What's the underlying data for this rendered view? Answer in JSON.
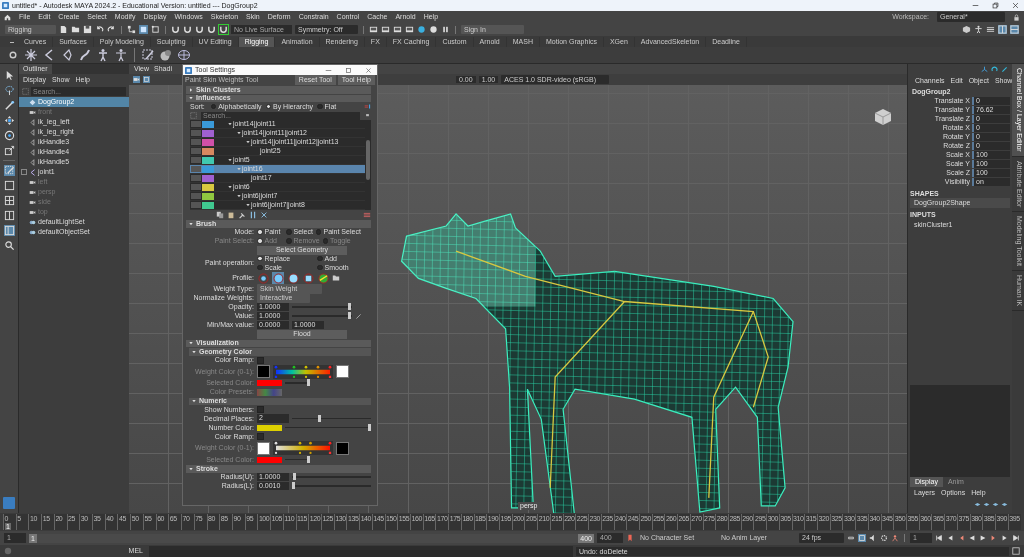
{
  "window": {
    "title": "untitled* - Autodesk MAYA 2024.2 - Educational Version: untitled  ---  DogGroup2"
  },
  "menu_bar": {
    "items": [
      "File",
      "Edit",
      "Create",
      "Select",
      "Modify",
      "Display",
      "Windows",
      "Skeleton",
      "Skin",
      "Deform",
      "Constrain",
      "Control",
      "Cache",
      "Arnold",
      "Help"
    ],
    "workspace_label": "Workspace:",
    "workspace_value": "General*"
  },
  "status_line": {
    "menu_set": "Rigging",
    "live_surface": "No Live Surface",
    "symmetry": "Symmetry: Off",
    "sign_in": "Sign In"
  },
  "shelf": {
    "tabs": [
      {
        "label": "Curves",
        "selected": false
      },
      {
        "label": "Surfaces",
        "selected": false
      },
      {
        "label": "Poly Modeling",
        "selected": false
      },
      {
        "label": "Sculpting",
        "selected": false
      },
      {
        "label": "UV Editing",
        "selected": false
      },
      {
        "label": "Rigging",
        "selected": true
      },
      {
        "label": "Animation",
        "selected": false
      },
      {
        "label": "Rendering",
        "selected": false
      },
      {
        "label": "FX",
        "selected": false
      },
      {
        "label": "FX Caching",
        "selected": false
      },
      {
        "label": "Custom",
        "selected": false
      },
      {
        "label": "Arnold",
        "selected": false
      },
      {
        "label": "MASH",
        "selected": false
      },
      {
        "label": "Motion Graphics",
        "selected": false
      },
      {
        "label": "XGen",
        "selected": false
      },
      {
        "label": "AdvancedSkeleton",
        "selected": false
      },
      {
        "label": "Deadline",
        "selected": false
      }
    ]
  },
  "outliner": {
    "title": "Outliner",
    "menu": [
      "Display",
      "Show",
      "Help"
    ],
    "search_placeholder": "Search...",
    "items": [
      {
        "label": "DogGroup2",
        "kind": "group",
        "selected": true,
        "hidden": false
      },
      {
        "label": "front",
        "kind": "camera",
        "selected": false,
        "hidden": true
      },
      {
        "label": "ik_leg_left",
        "kind": "ik",
        "selected": false,
        "hidden": false
      },
      {
        "label": "ik_leg_right",
        "kind": "ik",
        "selected": false,
        "hidden": false
      },
      {
        "label": "ikHandle3",
        "kind": "ik",
        "selected": false,
        "hidden": false
      },
      {
        "label": "ikHandle4",
        "kind": "ik",
        "selected": false,
        "hidden": false
      },
      {
        "label": "ikHandle5",
        "kind": "ik",
        "selected": false,
        "hidden": false
      },
      {
        "label": "joint1",
        "kind": "joint",
        "selected": false,
        "hidden": false
      },
      {
        "label": "left",
        "kind": "camera",
        "selected": false,
        "hidden": true
      },
      {
        "label": "persp",
        "kind": "camera",
        "selected": false,
        "hidden": true
      },
      {
        "label": "side",
        "kind": "camera",
        "selected": false,
        "hidden": true
      },
      {
        "label": "top",
        "kind": "camera",
        "selected": false,
        "hidden": true
      },
      {
        "label": "defaultLightSet",
        "kind": "set",
        "selected": false,
        "hidden": false
      },
      {
        "label": "defaultObjectSet",
        "kind": "set",
        "selected": false,
        "hidden": false
      }
    ]
  },
  "viewport": {
    "menu": [
      "View",
      "Shadi"
    ],
    "exposure": "0.00",
    "gamma": "1.00",
    "color_space": "ACES 1.0 SDR-video (sRGB)",
    "camera": "persp"
  },
  "tool_settings": {
    "title": "Tool Settings",
    "tool_name": "Paint Skin Weights Tool",
    "buttons": [
      "Reset Tool",
      "Tool Help"
    ],
    "skin_clusters": {
      "label": "Skin Clusters",
      "expanded": false
    },
    "influences": {
      "label": "Influences",
      "expanded": true,
      "sort_label": "Sort:",
      "sort_options": [
        {
          "label": "Alphabetically",
          "selected": false
        },
        {
          "label": "By Hierarchy",
          "selected": true
        },
        {
          "label": "Flat",
          "selected": false
        }
      ],
      "search_placeholder": "Search...",
      "rows": [
        {
          "label": "joint14|joint11",
          "color": "#3a9ad9",
          "selected": false,
          "expanded": true,
          "children": [
            {
              "label": "joint14|joint11|joint12",
              "color": "#a060d0",
              "selected": false,
              "expanded": true,
              "children": [
                {
                  "label": "joint14|joint11|joint12|joint13",
                  "color": "#d050a8",
                  "selected": false,
                  "expanded": true,
                  "children": [
                    {
                      "label": "joint25",
                      "color": "#d88860",
                      "selected": false,
                      "expanded": false
                    }
                  ]
                }
              ]
            }
          ]
        },
        {
          "label": "joint5",
          "color": "#40c8b0",
          "selected": false,
          "expanded": true,
          "children": [
            {
              "label": "joint16",
              "color": "#3a9ad9",
              "selected": true,
              "expanded": true,
              "children": [
                {
                  "label": "joint17",
                  "color": "#a060d0",
                  "selected": false,
                  "expanded": false
                }
              ]
            }
          ]
        },
        {
          "label": "joint6",
          "color": "#d8c840",
          "selected": false,
          "expanded": true,
          "children": [
            {
              "label": "joint6|joint7",
              "color": "#90c840",
              "selected": false,
              "expanded": true,
              "children": [
                {
                  "label": "joint6|joint7|joint8",
                  "color": "#40c890",
                  "selected": false,
                  "expanded": true
                }
              ]
            }
          ]
        }
      ]
    },
    "brush": {
      "label": "Brush",
      "expanded": true,
      "mode": {
        "label": "Mode:",
        "disabled": false,
        "options": [
          {
            "label": "Paint",
            "selected": true
          },
          {
            "label": "Select",
            "selected": false
          },
          {
            "label": "Paint Select",
            "selected": false
          }
        ]
      },
      "paint_select": {
        "label": "Paint Select:",
        "disabled": true,
        "options": [
          {
            "label": "Add",
            "selected": true
          },
          {
            "label": "Remove",
            "selected": false
          },
          {
            "label": "Toggle",
            "selected": false
          }
        ]
      },
      "select_geometry": "Select Geometry",
      "paint_operation": {
        "label": "Paint operation:",
        "options": [
          {
            "label": "Replace",
            "selected": true
          },
          {
            "label": "Add",
            "selected": false
          },
          {
            "label": "Scale",
            "selected": false
          },
          {
            "label": "Smooth",
            "selected": false
          }
        ]
      },
      "profile_label": "Profile:",
      "profiles": [
        {
          "kind": "soft",
          "selected": false
        },
        {
          "kind": "gaussian",
          "selected": true
        },
        {
          "kind": "solid",
          "selected": false
        },
        {
          "kind": "square",
          "selected": false
        },
        {
          "kind": "image",
          "selected": false
        }
      ],
      "weight_type": {
        "label": "Weight Type:",
        "value": "Skin Weight"
      },
      "normalize": {
        "label": "Normalize Weights:",
        "value": "Interactive"
      },
      "opacity": {
        "label": "Opacity:",
        "value": "1.0000",
        "level": 1
      },
      "value": {
        "label": "Value:",
        "value": "1.0000",
        "level": 1
      },
      "minmax": {
        "label": "Min/Max value:",
        "min": "0.0000",
        "max": "1.0000"
      },
      "flood": "Flood"
    },
    "visualization": {
      "label": "Visualization",
      "expanded": true
    },
    "geometry_color": {
      "label": "Geometry Color",
      "expanded": true,
      "color_ramp_label": "Color Ramp:",
      "color_ramp": false,
      "weight_color_label": "Weight Color (0-1):",
      "selected_color_label": "Selected Color:",
      "color_presets_label": "Color Presets:"
    },
    "numeric": {
      "label": "Numeric",
      "expanded": true,
      "show_numbers_label": "Show Numbers:",
      "show_numbers": false,
      "decimal_places_label": "Decimal Places:",
      "decimal_places": {
        "value": "2",
        "level": 0.35
      },
      "number_color_label": "Number Color:",
      "color_ramp_label": "Color Ramp:",
      "color_ramp": false,
      "weight_color_label": "Weight Color (0-1):",
      "selected_color_label": "Selected Color:"
    },
    "stroke": {
      "label": "Stroke",
      "expanded": true,
      "radius_u_label": "Radius(U):",
      "radius_u": {
        "value": "1.0000",
        "level": 0.02
      },
      "radius_l_label": "Radius(L):",
      "radius_l": {
        "value": "0.0010",
        "level": 0
      }
    }
  },
  "channel_box": {
    "menu": [
      "Channels",
      "Edit",
      "Object",
      "Show"
    ],
    "object": "DogGroup2",
    "attributes": [
      {
        "name": "Translate X",
        "value": "0"
      },
      {
        "name": "Translate Y",
        "value": "76.62"
      },
      {
        "name": "Translate Z",
        "value": "0"
      },
      {
        "name": "Rotate X",
        "value": "0"
      },
      {
        "name": "Rotate Y",
        "value": "0"
      },
      {
        "name": "Rotate Z",
        "value": "0"
      },
      {
        "name": "Scale X",
        "value": "100"
      },
      {
        "name": "Scale Y",
        "value": "100"
      },
      {
        "name": "Scale Z",
        "value": "100"
      },
      {
        "name": "Visibility",
        "value": "on"
      }
    ],
    "shapes_label": "SHAPES",
    "shape": "DogGroup2Shape",
    "inputs_label": "INPUTS",
    "input": "skinCluster1"
  },
  "side_tabs": [
    {
      "label": "Channel Box / Layer Editor",
      "selected": true
    },
    {
      "label": "Attribute Editor",
      "selected": false
    },
    {
      "label": "Modeling Toolkit",
      "selected": false
    },
    {
      "label": "Human IK",
      "selected": false
    }
  ],
  "layer_editor": {
    "tabs": [
      {
        "label": "Display",
        "selected": true
      },
      {
        "label": "Anim",
        "selected": false
      }
    ],
    "menu": [
      "Layers",
      "Options",
      "Help"
    ]
  },
  "timeline": {
    "ticks": [
      "0",
      "5",
      "10",
      "15",
      "20",
      "25",
      "30",
      "35",
      "40",
      "45",
      "50",
      "55",
      "60",
      "65",
      "70",
      "75",
      "80",
      "85",
      "90",
      "95",
      "100",
      "105",
      "110",
      "115",
      "120",
      "125",
      "130",
      "135",
      "140",
      "145",
      "150",
      "155",
      "160",
      "165",
      "170",
      "175",
      "180",
      "185",
      "190",
      "195",
      "200",
      "205",
      "210",
      "215",
      "220",
      "225",
      "230",
      "235",
      "240",
      "245",
      "250",
      "255",
      "260",
      "265",
      "270",
      "275",
      "280",
      "285",
      "290",
      "295",
      "300",
      "305",
      "310",
      "315",
      "320",
      "325",
      "330",
      "335",
      "340",
      "345",
      "350",
      "355",
      "360",
      "365",
      "370",
      "375",
      "380",
      "385",
      "390",
      "395"
    ],
    "playhead": "1",
    "level": 0,
    "current_frame": "1"
  },
  "range": {
    "start": "1",
    "level": 1,
    "range_start": "1",
    "range_end": "400",
    "end": "400",
    "character_set": "No Character Set",
    "anim_layer": "No Anim Layer",
    "fps": "24 fps"
  },
  "command_line": {
    "language": "MEL",
    "result": "Undo: doDelete"
  }
}
